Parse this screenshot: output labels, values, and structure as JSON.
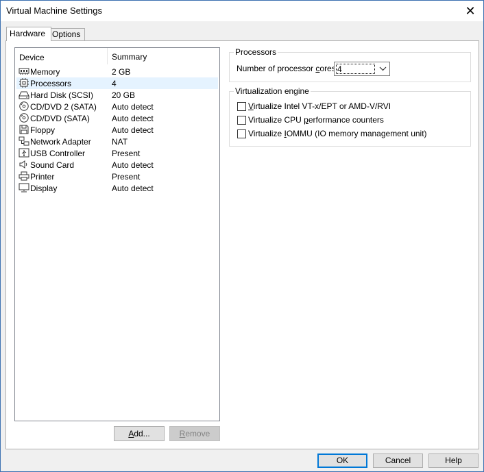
{
  "window": {
    "title": "Virtual Machine Settings"
  },
  "tabs": [
    {
      "label": "Hardware"
    },
    {
      "label": "Options"
    }
  ],
  "device_list": {
    "headers": {
      "device": "Device",
      "summary": "Summary"
    },
    "rows": [
      {
        "name": "Memory",
        "summary": "2 GB",
        "icon": "memory-icon"
      },
      {
        "name": "Processors",
        "summary": "4",
        "icon": "processor-icon",
        "selected": true
      },
      {
        "name": "Hard Disk (SCSI)",
        "summary": "20 GB",
        "icon": "hard-disk-icon"
      },
      {
        "name": "CD/DVD 2 (SATA)",
        "summary": "Auto detect",
        "icon": "cd-dvd-icon"
      },
      {
        "name": "CD/DVD (SATA)",
        "summary": "Auto detect",
        "icon": "cd-dvd-icon"
      },
      {
        "name": "Floppy",
        "summary": "Auto detect",
        "icon": "floppy-icon"
      },
      {
        "name": "Network Adapter",
        "summary": "NAT",
        "icon": "network-adapter-icon"
      },
      {
        "name": "USB Controller",
        "summary": "Present",
        "icon": "usb-controller-icon"
      },
      {
        "name": "Sound Card",
        "summary": "Auto detect",
        "icon": "sound-card-icon"
      },
      {
        "name": "Printer",
        "summary": "Present",
        "icon": "printer-icon"
      },
      {
        "name": "Display",
        "summary": "Auto detect",
        "icon": "display-icon"
      }
    ],
    "add_button": {
      "pre": "",
      "ul": "A",
      "post": "dd..."
    },
    "remove_button": {
      "pre": "",
      "ul": "R",
      "post": "emove"
    }
  },
  "processors": {
    "group_label": "Processors",
    "cores_label": {
      "pre": "Number of processor ",
      "ul": "c",
      "post": "ores:"
    },
    "cores_value": "4"
  },
  "virtualization": {
    "group_label": "Virtualization engine",
    "options": [
      {
        "pre": "",
        "ul": "V",
        "post": "irtualize Intel VT-x/EPT or AMD-V/RVI",
        "checked": false
      },
      {
        "pre": "Virtualize CPU ",
        "ul": "p",
        "post": "erformance counters",
        "checked": false
      },
      {
        "pre": "Virtualize ",
        "ul": "I",
        "post": "OMMU (IO memory management unit)",
        "checked": false
      }
    ]
  },
  "footer": {
    "ok": "OK",
    "cancel": "Cancel",
    "help": "Help"
  }
}
